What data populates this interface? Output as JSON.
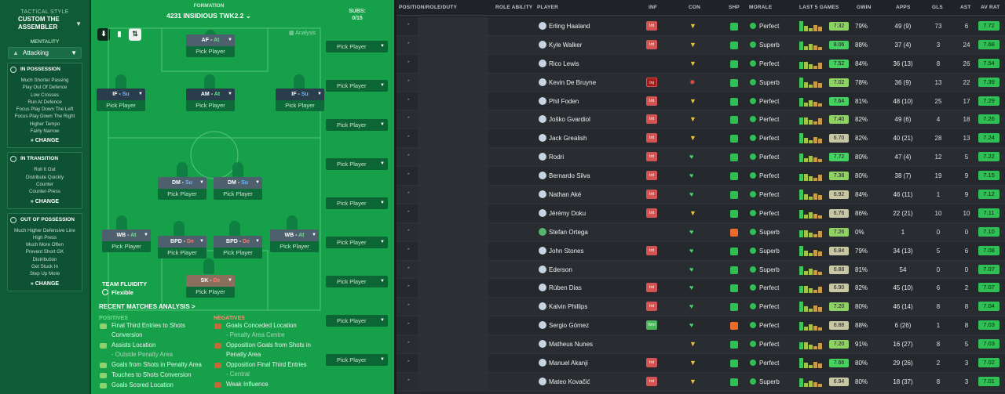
{
  "tactic": {
    "style_label": "TACTICAL STYLE",
    "style_name": "CUSTOM THE ASSEMBLER",
    "mentality_label": "MENTALITY",
    "mentality_value": "Attacking",
    "in_possession": {
      "title": "IN POSSESSION",
      "items": [
        "Much Shorter Passing",
        "Play Out Of Defence",
        "Low Crosses",
        "Run At Defence",
        "Focus Play Down The Left",
        "Focus Play Down The Right",
        "Higher Tempo",
        "Fairly Narrow"
      ],
      "change": "CHANGE"
    },
    "in_transition": {
      "title": "IN TRANSITION",
      "items": [
        "Roll It Out",
        "Distribute Quickly",
        "Counter",
        "Counter-Press"
      ],
      "change": "CHANGE"
    },
    "out_of_possession": {
      "title": "OUT OF POSSESSION",
      "items": [
        "Much Higher Defensive Line",
        "High Press",
        "Much More Often",
        "Prevent Short GK",
        "Distribution",
        "Get Stuck In",
        "Step Up More"
      ],
      "change": "CHANGE"
    }
  },
  "pitch": {
    "formation_label": "FORMATION",
    "formation_name": "4231 INSIDIOUS TWK2.2",
    "subs_label": "SUBS:",
    "subs_count": "0/15",
    "analysis_label": "Analysis",
    "pick_label": "Pick Player",
    "positions": [
      {
        "role": "AF",
        "duty": "At"
      },
      {
        "role": "IF",
        "duty": "Su"
      },
      {
        "role": "AM",
        "duty": "At"
      },
      {
        "role": "IF",
        "duty": "Su"
      },
      {
        "role": "DM",
        "duty": "Su"
      },
      {
        "role": "DM",
        "duty": "Su"
      },
      {
        "role": "WB",
        "duty": "At"
      },
      {
        "role": "BPD",
        "duty": "De"
      },
      {
        "role": "BPD",
        "duty": "De"
      },
      {
        "role": "WB",
        "duty": "At"
      },
      {
        "role": "SK",
        "duty": "De"
      }
    ],
    "fluidity_label": "TEAM FLUIDITY",
    "fluidity_value": "Flexible"
  },
  "analysis": {
    "title": "RECENT MATCHES ANALYSIS >",
    "positives_label": "POSITIVES",
    "negatives_label": "NEGATIVES",
    "positives": [
      {
        "text": "Final Third Entries to Shots Conversion",
        "sub": ""
      },
      {
        "text": "Assists Location",
        "sub": "- Outside Penalty Area"
      },
      {
        "text": "Goals from Shots in Penalty Area",
        "sub": ""
      },
      {
        "text": "Touches to Shots Conversion",
        "sub": ""
      },
      {
        "text": "Goals Scored Location",
        "sub": ""
      }
    ],
    "negatives": [
      {
        "text": "Goals Conceded Location",
        "sub": "- Penalty Area Centre"
      },
      {
        "text": "Opposition Goals from Shots in Penalty Area",
        "sub": ""
      },
      {
        "text": "Opposition Final Third Entries",
        "sub": "- Central"
      },
      {
        "text": "Weak Influence",
        "sub": ""
      }
    ]
  },
  "table": {
    "headers": {
      "position": "POSITION/ROLE/DUTY",
      "role_ability": "ROLE ABILITY",
      "player": "PLAYER",
      "inf": "INF",
      "con": "CON",
      "shp": "SHP",
      "morale": "MORALE",
      "last5": "LAST 5 GAMES",
      "gwin": "GWIN",
      "apps": "APPS",
      "gls": "GLS",
      "ast": "AST",
      "avrat": "AV RAT"
    },
    "rows": [
      {
        "name": "Erling Haaland",
        "inf": "Int",
        "con": "yellow",
        "shp": "green",
        "morale": "Perfect",
        "last5": "7.32",
        "gwin": "79%",
        "apps": "49 (9)",
        "gls": "73",
        "ast": "6",
        "avrat": "7.72"
      },
      {
        "name": "Kyle Walker",
        "inf": "Int",
        "con": "yellow",
        "shp": "green",
        "morale": "Superb",
        "last5": "8.06",
        "gwin": "88%",
        "apps": "37 (4)",
        "gls": "3",
        "ast": "24",
        "avrat": "7.68"
      },
      {
        "name": "Rico Lewis",
        "inf": "",
        "con": "yellow",
        "shp": "green",
        "morale": "Perfect",
        "last5": "7.52",
        "gwin": "84%",
        "apps": "36 (13)",
        "gls": "8",
        "ast": "26",
        "avrat": "7.54"
      },
      {
        "name": "Kevin De Bruyne",
        "inf": "Inj",
        "con": "red",
        "shp": "green",
        "morale": "Superb",
        "last5": "7.02",
        "gwin": "78%",
        "apps": "36 (9)",
        "gls": "13",
        "ast": "22",
        "avrat": "7.39"
      },
      {
        "name": "Phil Foden",
        "inf": "Int",
        "con": "yellow",
        "shp": "green",
        "morale": "Perfect",
        "last5": "7.64",
        "gwin": "81%",
        "apps": "48 (10)",
        "gls": "25",
        "ast": "17",
        "avrat": "7.29"
      },
      {
        "name": "Joško Gvardiol",
        "inf": "Int",
        "con": "yellow",
        "shp": "green",
        "morale": "Perfect",
        "last5": "7.40",
        "gwin": "82%",
        "apps": "49 (6)",
        "gls": "4",
        "ast": "18",
        "avrat": "7.26"
      },
      {
        "name": "Jack Grealish",
        "inf": "Int",
        "con": "yellow",
        "shp": "green",
        "morale": "Perfect",
        "last5": "6.70",
        "gwin": "82%",
        "apps": "40 (21)",
        "gls": "28",
        "ast": "13",
        "avrat": "7.24"
      },
      {
        "name": "Rodri",
        "inf": "Int",
        "con": "green",
        "shp": "green",
        "morale": "Perfect",
        "last5": "7.72",
        "gwin": "80%",
        "apps": "47 (4)",
        "gls": "12",
        "ast": "5",
        "avrat": "7.22"
      },
      {
        "name": "Bernardo Silva",
        "inf": "Int",
        "con": "green",
        "shp": "green",
        "morale": "Perfect",
        "last5": "7.38",
        "gwin": "80%",
        "apps": "38 (7)",
        "gls": "19",
        "ast": "9",
        "avrat": "7.15"
      },
      {
        "name": "Nathan Aké",
        "inf": "Int",
        "con": "green",
        "shp": "green",
        "morale": "Perfect",
        "last5": "6.92",
        "gwin": "84%",
        "apps": "46 (11)",
        "gls": "1",
        "ast": "9",
        "avrat": "7.12"
      },
      {
        "name": "Jérémy Doku",
        "inf": "Int",
        "con": "yellow",
        "shp": "green",
        "morale": "Perfect",
        "last5": "6.76",
        "gwin": "86%",
        "apps": "22 (21)",
        "gls": "10",
        "ast": "10",
        "avrat": "7.11"
      },
      {
        "name": "Stefan Ortega",
        "inf": "",
        "con": "green",
        "shp": "orange",
        "morale": "Superb",
        "last5": "7.26",
        "gwin": "0%",
        "apps": "1",
        "gls": "0",
        "ast": "0",
        "avrat": "7.10"
      },
      {
        "name": "John Stones",
        "inf": "Int",
        "con": "green",
        "shp": "green",
        "morale": "Superb",
        "last5": "6.84",
        "gwin": "79%",
        "apps": "34 (13)",
        "gls": "5",
        "ast": "6",
        "avrat": "7.08"
      },
      {
        "name": "Ederson",
        "inf": "",
        "con": "green",
        "shp": "green",
        "morale": "Superb",
        "last5": "6.88",
        "gwin": "81%",
        "apps": "54",
        "gls": "0",
        "ast": "0",
        "avrat": "7.07"
      },
      {
        "name": "Rúben Dias",
        "inf": "Int",
        "con": "green",
        "shp": "green",
        "morale": "Perfect",
        "last5": "6.90",
        "gwin": "82%",
        "apps": "45 (10)",
        "gls": "6",
        "ast": "2",
        "avrat": "7.07"
      },
      {
        "name": "Kalvin Phillips",
        "inf": "Int",
        "con": "green",
        "shp": "green",
        "morale": "Perfect",
        "last5": "7.20",
        "gwin": "80%",
        "apps": "46 (14)",
        "gls": "8",
        "ast": "8",
        "avrat": "7.04"
      },
      {
        "name": "Sergio Gómez",
        "inf": "Wnt",
        "con": "green",
        "shp": "orange",
        "morale": "Perfect",
        "last5": "6.88",
        "gwin": "88%",
        "apps": "6 (26)",
        "gls": "1",
        "ast": "8",
        "avrat": "7.03"
      },
      {
        "name": "Matheus Nunes",
        "inf": "",
        "con": "yellow",
        "shp": "green",
        "morale": "Perfect",
        "last5": "7.20",
        "gwin": "91%",
        "apps": "16 (27)",
        "gls": "8",
        "ast": "5",
        "avrat": "7.03"
      },
      {
        "name": "Manuel Akanji",
        "inf": "Int",
        "con": "yellow",
        "shp": "green",
        "morale": "Perfect",
        "last5": "7.66",
        "gwin": "80%",
        "apps": "29 (26)",
        "gls": "2",
        "ast": "3",
        "avrat": "7.02"
      },
      {
        "name": "Mateo Kovačić",
        "inf": "Int",
        "con": "yellow",
        "shp": "green",
        "morale": "Superb",
        "last5": "6.94",
        "gwin": "80%",
        "apps": "18 (37)",
        "gls": "8",
        "ast": "3",
        "avrat": "7.01"
      }
    ]
  },
  "colors": {
    "pitch": "#16a04a",
    "panel": "#0f5b36",
    "good": "#2fbf55",
    "warn": "#ee6b2b",
    "bad": "#d45353"
  }
}
